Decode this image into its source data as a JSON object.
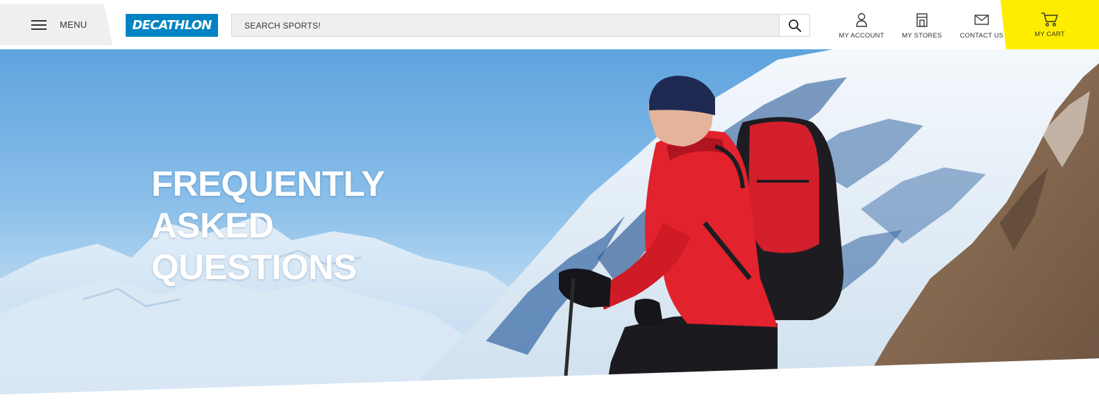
{
  "header": {
    "menu_label": "MENU",
    "logo_text": "DECATHLON",
    "search": {
      "placeholder": "SEARCH SPORTS!",
      "value": ""
    },
    "nav": {
      "account_label": "MY ACCOUNT",
      "stores_label": "MY STORES",
      "contact_label": "CONTACT US",
      "cart_label": "MY CART"
    }
  },
  "hero": {
    "title_lines": [
      "FREQUENTLY",
      "ASKED",
      "QUESTIONS"
    ]
  },
  "colors": {
    "brand_blue": "#0082c3",
    "cart_yellow": "#ffed00",
    "menu_bg": "#efefef"
  },
  "icons": [
    "hamburger-icon",
    "search-icon",
    "user-icon",
    "store-icon",
    "mail-icon",
    "cart-icon"
  ]
}
